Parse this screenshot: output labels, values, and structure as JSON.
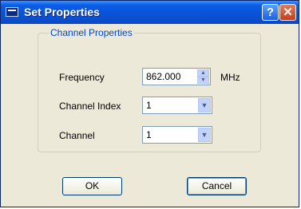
{
  "window": {
    "title": "Set Properties",
    "help_symbol": "?",
    "close_symbol": "✕"
  },
  "group": {
    "title": "Channel Properties"
  },
  "fields": {
    "frequency": {
      "label": "Frequency",
      "value": "862.000",
      "unit": "MHz"
    },
    "channel_index": {
      "label": "Channel Index",
      "value": "1"
    },
    "channel": {
      "label": "Channel",
      "value": "1"
    }
  },
  "buttons": {
    "ok": "OK",
    "cancel": "Cancel"
  },
  "icons": {
    "app": "dialog-icon",
    "help": "help-icon",
    "close": "close-icon",
    "spin_up": "arrow-up-icon",
    "spin_down": "arrow-down-icon",
    "dropdown": "chevron-down-icon"
  },
  "colors": {
    "titlebar": "#0a52d6",
    "dialog_bg": "#ece9d8",
    "group_title": "#0046d5",
    "close_button": "#c43f1b"
  }
}
